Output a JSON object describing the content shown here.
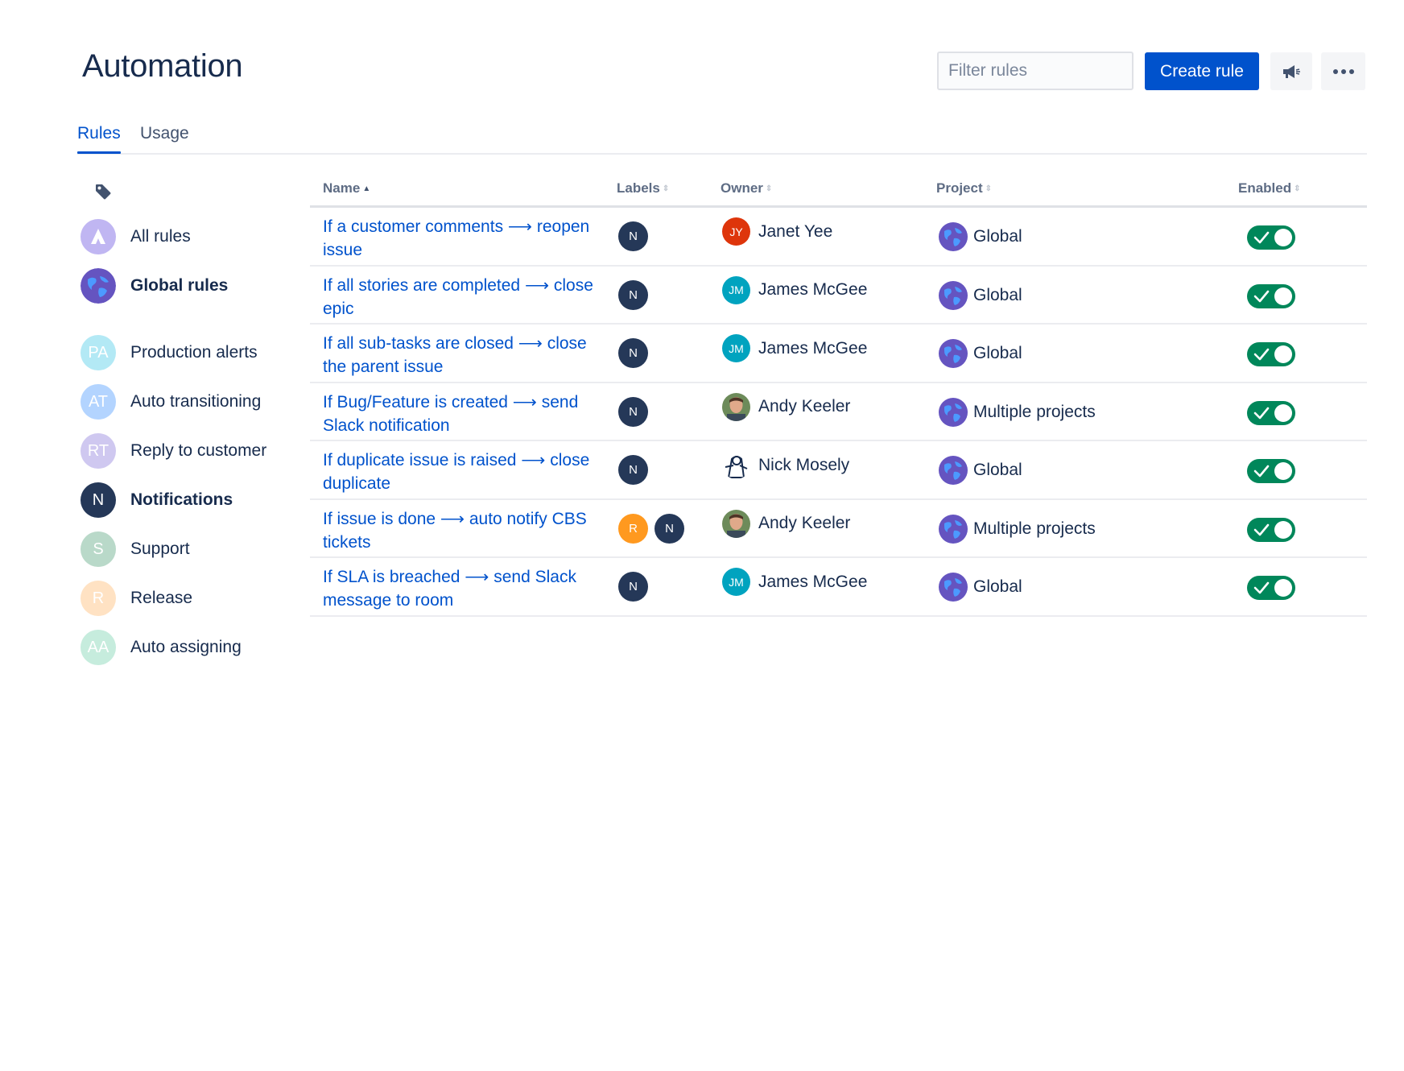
{
  "header": {
    "title": "Automation",
    "filter_placeholder": "Filter rules",
    "create_label": "Create rule"
  },
  "tabs": [
    {
      "label": "Rules",
      "active": true
    },
    {
      "label": "Usage",
      "active": false
    }
  ],
  "sidebar": {
    "items": [
      {
        "label": "All rules",
        "avatar": "",
        "color": "#c0b6f2",
        "bold": false
      },
      {
        "label": "Global rules",
        "avatar": "",
        "color": "#6554c0",
        "bold": true
      },
      {
        "label": "Production alerts",
        "avatar": "PA",
        "color": "#b3e9f5",
        "bold": false
      },
      {
        "label": "Auto transitioning",
        "avatar": "AT",
        "color": "#b3d4ff",
        "bold": false
      },
      {
        "label": "Reply to customer",
        "avatar": "RT",
        "color": "#cfc8f0",
        "bold": false
      },
      {
        "label": "Notifications",
        "avatar": "N",
        "color": "#253858",
        "bold": true
      },
      {
        "label": "Support",
        "avatar": "S",
        "color": "#b9d9c9",
        "bold": false
      },
      {
        "label": "Release",
        "avatar": "R",
        "color": "#ffe2c3",
        "bold": false
      },
      {
        "label": "Auto assigning",
        "avatar": "AA",
        "color": "#c6ecdd",
        "bold": false
      }
    ]
  },
  "table": {
    "columns": [
      "Name",
      "Labels",
      "Owner",
      "Project",
      "Enabled"
    ],
    "rows": [
      {
        "name": "If a customer comments ⟶ reopen issue",
        "labels": [
          "N"
        ],
        "owner": "Janet Yee",
        "owner_initials": "JY",
        "owner_color": "#de350b",
        "project": "Global",
        "enabled": true
      },
      {
        "name": "If all stories are completed ⟶ close epic",
        "labels": [
          "N"
        ],
        "owner": "James McGee",
        "owner_initials": "JM",
        "owner_color": "#00a3bf",
        "project": "Global",
        "enabled": true
      },
      {
        "name": "If all sub-tasks are closed ⟶ close the parent issue",
        "labels": [
          "N"
        ],
        "owner": "James McGee",
        "owner_initials": "JM",
        "owner_color": "#00a3bf",
        "project": "Global",
        "enabled": true
      },
      {
        "name": "If Bug/Feature is created ⟶ send Slack notification",
        "labels": [
          "N"
        ],
        "owner": "Andy Keeler",
        "owner_initials": "",
        "owner_color": "#8d6e63",
        "project": "Multiple projects",
        "enabled": true
      },
      {
        "name": "If duplicate issue is raised ⟶ close duplicate",
        "labels": [
          "N"
        ],
        "owner": "Nick Mosely",
        "owner_initials": "",
        "owner_color": "#ffffff",
        "project": "Global",
        "enabled": true
      },
      {
        "name": "If issue is done ⟶ auto notify CBS tickets",
        "labels": [
          "R",
          "N"
        ],
        "owner": "Andy Keeler",
        "owner_initials": "",
        "owner_color": "#8d6e63",
        "project": "Multiple projects",
        "enabled": true
      },
      {
        "name": "If SLA is breached ⟶ send Slack message to room",
        "labels": [
          "N"
        ],
        "owner": "James McGee",
        "owner_initials": "JM",
        "owner_color": "#00a3bf",
        "project": "Global",
        "enabled": true
      }
    ]
  },
  "colors": {
    "brand": "#0052cc",
    "toggle_on": "#00875a",
    "label_n": "#253858",
    "label_r": "#ff991f"
  }
}
